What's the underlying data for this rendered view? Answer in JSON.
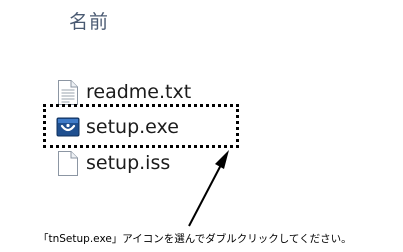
{
  "header": {
    "column_name": "名前"
  },
  "files": [
    {
      "name": "readme.txt",
      "icon": "text-file-icon"
    },
    {
      "name": "setup.exe",
      "icon": "installer-app-icon"
    },
    {
      "name": "setup.iss",
      "icon": "blank-file-icon"
    }
  ],
  "annotation": {
    "caption": "「tnSetup.exe」アイコンを選んでダブルクリックしてください。",
    "highlight_color": "#000000"
  }
}
